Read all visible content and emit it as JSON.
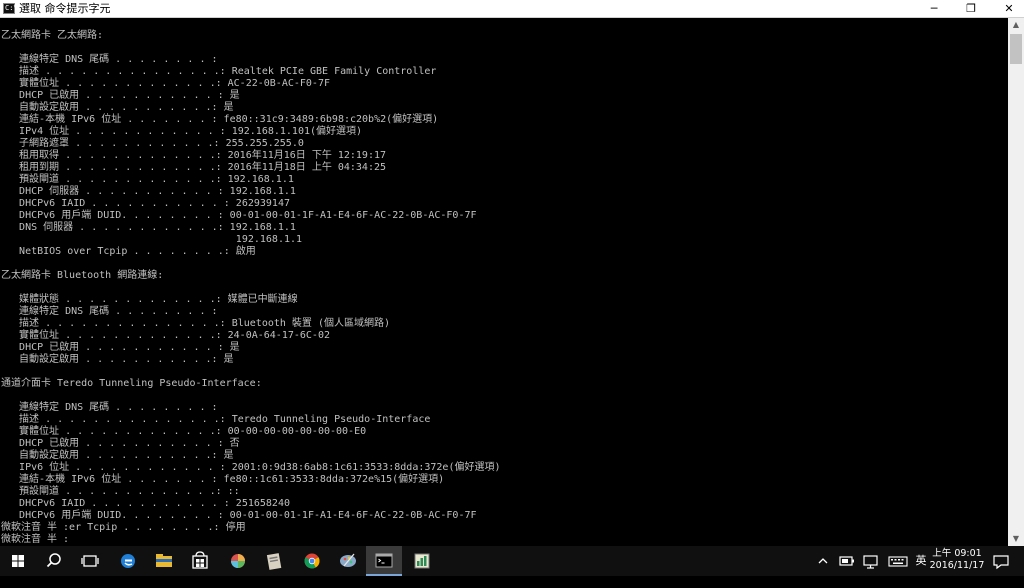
{
  "window": {
    "title": "選取 命令提示字元",
    "icon_label": "C:\\",
    "minimize_glyph": "─",
    "maximize_glyph": "❐",
    "close_glyph": "✕"
  },
  "console_lines": [
    "",
    "乙太網路卡 乙太網路:",
    "",
    "   連線特定 DNS 尾碼 . . . . . . . . :",
    "   描述 . . . . . . . . . . . . . . .: Realtek PCIe GBE Family Controller",
    "   實體位址 . . . . . . . . . . . . .: AC-22-0B-AC-F0-7F",
    "   DHCP 已啟用 . . . . . . . . . . . : 是",
    "   自動設定啟用 . . . . . . . . . . .: 是",
    "   連結-本機 IPv6 位址 . . . . . . . : fe80::31c9:3489:6b98:c20b%2(偏好選項)",
    "   IPv4 位址 . . . . . . . . . . . . : 192.168.1.101(偏好選項)",
    "   子網路遮罩 . . . . . . . . . . . .: 255.255.255.0",
    "   租用取得 . . . . . . . . . . . . .: 2016年11月16日 下午 12:19:17",
    "   租用到期 . . . . . . . . . . . . .: 2016年11月18日 上午 04:34:25",
    "   預設閘道 . . . . . . . . . . . . .: 192.168.1.1",
    "   DHCP 伺服器 . . . . . . . . . . . : 192.168.1.1",
    "   DHCPv6 IAID . . . . . . . . . . . : 262939147",
    "   DHCPv6 用戶端 DUID. . . . . . . . : 00-01-00-01-1F-A1-E4-6F-AC-22-0B-AC-F0-7F",
    "   DNS 伺服器 . . . . . . . . . . . .: 192.168.1.1",
    "                                       192.168.1.1",
    "   NetBIOS over Tcpip . . . . . . . .: 啟用",
    "",
    "乙太網路卡 Bluetooth 網路連線:",
    "",
    "   媒體狀態 . . . . . . . . . . . . .: 媒體已中斷連線",
    "   連線特定 DNS 尾碼 . . . . . . . . :",
    "   描述 . . . . . . . . . . . . . . .: Bluetooth 裝置 (個人區域網路)",
    "   實體位址 . . . . . . . . . . . . .: 24-0A-64-17-6C-02",
    "   DHCP 已啟用 . . . . . . . . . . . : 是",
    "   自動設定啟用 . . . . . . . . . . .: 是",
    "",
    "通道介面卡 Teredo Tunneling Pseudo-Interface:",
    "",
    "   連線特定 DNS 尾碼 . . . . . . . . :",
    "   描述 . . . . . . . . . . . . . . .: Teredo Tunneling Pseudo-Interface",
    "   實體位址 . . . . . . . . . . . . .: 00-00-00-00-00-00-00-E0",
    "   DHCP 已啟用 . . . . . . . . . . . : 否",
    "   自動設定啟用 . . . . . . . . . . .: 是",
    "   IPv6 位址 . . . . . . . . . . . . : 2001:0:9d38:6ab8:1c61:3533:8dda:372e(偏好選項)",
    "   連結-本機 IPv6 位址 . . . . . . . : fe80::1c61:3533:8dda:372e%15(偏好選項)",
    "   預設閘道 . . . . . . . . . . . . .: ::",
    "   DHCPv6 IAID . . . . . . . . . . . : 251658240",
    "   DHCPv6 用戶端 DUID. . . . . . . . : 00-01-00-01-1F-A1-E4-6F-AC-22-0B-AC-F0-7F",
    "微軟注音 半 :er Tcpip . . . . . . . .: 停用",
    "微軟注音 半 :"
  ],
  "colors": {
    "console_bg": "#000000",
    "console_text": "#c0c0c0",
    "taskbar_bg": "#101010",
    "accent": "#7aa6d8"
  },
  "taskbar": {
    "icons": [
      "windows-start-icon",
      "search-icon",
      "task-view-icon",
      "edge-browser-icon",
      "file-explorer-icon",
      "store-icon",
      "app-colorful-icon",
      "app-document-icon",
      "chrome-icon",
      "app-paint-icon",
      "command-prompt-icon",
      "app-chart-icon"
    ],
    "active_app": "command-prompt-icon"
  },
  "tray": {
    "ime_label": "英",
    "time": "上午 09:01",
    "date": "2016/11/17"
  }
}
